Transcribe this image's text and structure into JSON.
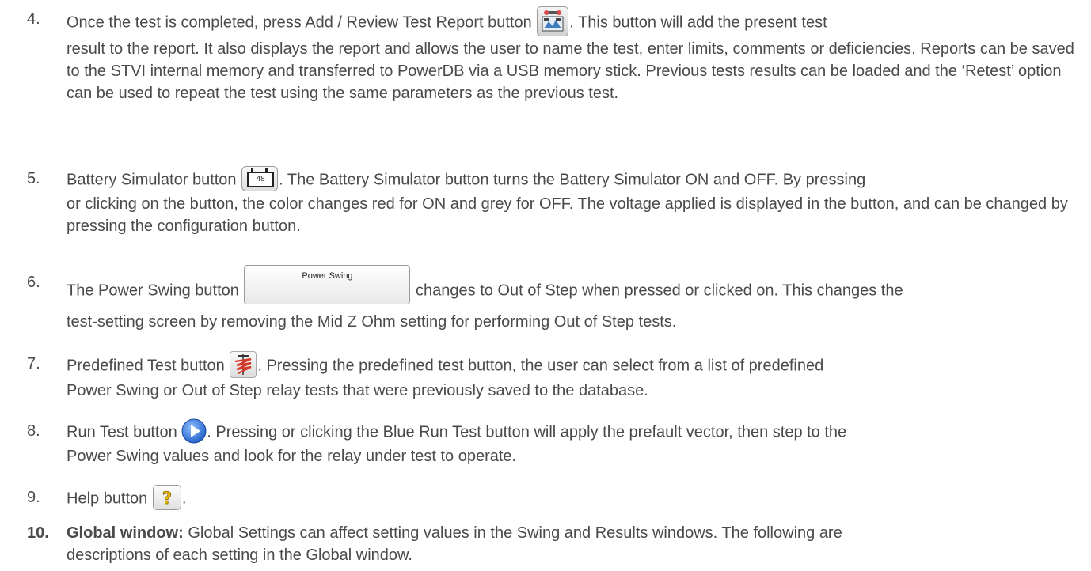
{
  "items": [
    {
      "num": "4.",
      "line1_a": "Once the test is completed, press Add / Review Test Report button",
      "line1_b": ". This button will add the present test",
      "rest": "result to the report.  It also displays the report and allows the user to name the test, enter limits, comments or deficiencies. Reports can be saved to the STVI internal memory and transferred to PowerDB via a USB memory stick.  Previous tests results can be loaded and the ‘Retest’ option can be used to repeat the test using the same parameters as the previous test."
    },
    {
      "num": "5.",
      "line1_a": "Battery Simulator button",
      "battery_value": "48",
      "line1_b": ". The Battery Simulator button turns the Battery Simulator ON and OFF. By pressing",
      "rest": "or clicking on the button, the color changes red for ON and grey for OFF.  The voltage applied is displayed in the button, and can be changed by pressing the configuration button."
    },
    {
      "num": "6.",
      "line1_a": "The Power Swing button",
      "button_label": "Power Swing",
      "line1_b": "changes to Out of Step when pressed or clicked on. This changes the",
      "rest": "test-setting screen by removing the Mid Z Ohm setting for performing Out of Step tests."
    },
    {
      "num": "7.",
      "line1_a": "Predefined Test button",
      "line1_b": ". Pressing the predefined test button, the user can select from a list of predefined",
      "rest": "Power Swing or Out of Step relay tests that were previously saved to the database."
    },
    {
      "num": "8.",
      "line1_a": "Run Test button",
      "line1_b": ". Pressing or clicking the Blue Run Test button will apply the prefault vector, then step to the",
      "rest": "Power Swing values and look for the relay under test to operate."
    },
    {
      "num": "9.",
      "line1_a": "Help button",
      "line1_b": "."
    },
    {
      "num": "10.",
      "heading": "Global window:",
      "line1_b": " Global Settings can affect setting values in the Swing and Results windows. The following are",
      "rest": "descriptions of each setting in the Global window."
    }
  ],
  "icons": {
    "report": "add-review-test-report-icon",
    "battery": "battery-simulator-icon",
    "predefined": "predefined-test-icon",
    "run": "run-test-icon",
    "help": "help-icon"
  },
  "colors": {
    "text": "#4a4a4a",
    "run_blue": "#2f6fd6",
    "help_yellow": "#e8b800",
    "predefined_red": "#d23b2a"
  }
}
